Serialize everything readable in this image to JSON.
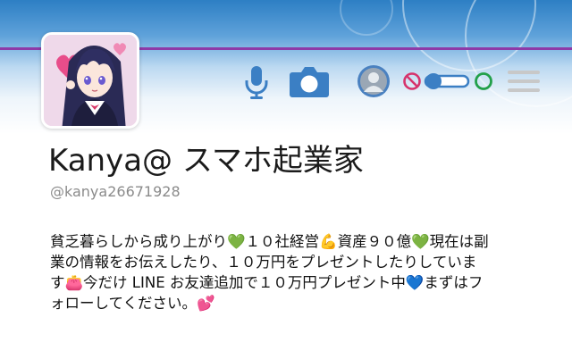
{
  "profile": {
    "display_name": "Kanya@ スマホ起業家",
    "handle": "@kanya26671928",
    "bio_lines": [
      "貧乏暮らしから成り上がり💚１０社経営💪資産９０億💚現在は副",
      "業の情報をお伝えしたり、１０万円をプレゼントしたりしていま",
      "す👛今だけ LINE お友達追加で１０万円プレゼント中💙まずはフ",
      "ォローしてください。💕"
    ]
  },
  "toolbar": {
    "icons": [
      "microphone-icon",
      "camera-icon",
      "avatar-icon",
      "no-entry-icon",
      "toggle-icon",
      "circle-icon",
      "menu-icon"
    ],
    "toggle_state": "off"
  },
  "colors": {
    "accent": "#3b7fc4",
    "header_top": "#2d7fc4",
    "purple_line": "#8e3aa8",
    "forbidden": "#d6336c",
    "green_circle": "#22a04a"
  }
}
